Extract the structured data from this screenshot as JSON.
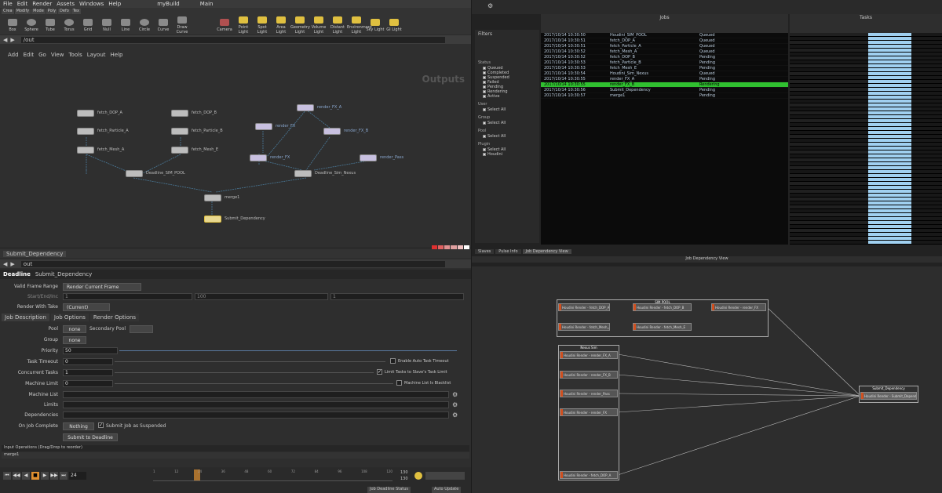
{
  "menubar": [
    "File",
    "Edit",
    "Render",
    "Assets",
    "Windows",
    "Help"
  ],
  "build": "myBuild",
  "desktop": "Main",
  "shelf_tabs": [
    "Crea",
    "Modify",
    "Mode",
    "Poly",
    "Defo",
    "Tex"
  ],
  "shelf_tools": [
    "Box",
    "Sphere",
    "Tube",
    "Torus",
    "Grid",
    "Null",
    "Line",
    "Circle",
    "Curve",
    "Draw Curve"
  ],
  "light_tools": [
    "Camera",
    "Point Light",
    "Spot Light",
    "Area Light",
    "Geometry Light",
    "Volume Light",
    "Distant Light",
    "Environment Light",
    "Sky Light",
    "GI Light"
  ],
  "net_path": "/out",
  "net_menu": [
    "Add",
    "Edit",
    "Go",
    "View",
    "Tools",
    "Layout",
    "Help"
  ],
  "net_title": "Outputs",
  "nodes": {
    "n1": "fetch_DOP_A",
    "n2": "fetch_Particle_A",
    "n3": "fetch_Mesh_A",
    "n4": "fetch_DOP_B",
    "n5": "fetch_Particle_B",
    "n6": "fetch_Mesh_E",
    "n7": "render_FX_A",
    "n8": "render_FX",
    "n9": "render_FX_B",
    "n10": "render_FX",
    "n11": "render_Pass",
    "n12": "Deadline_SIM_POOL",
    "n13": "Deadline_Sim_Nexus",
    "n14": "merge1",
    "n15": "Submit_Dependency"
  },
  "swatch_colors": [
    "#e03030",
    "#e06060",
    "#e09090",
    "#e0a0a0",
    "#f0c0c0",
    "#ffffff",
    "#e08030",
    "#e0b030",
    "#e0e030",
    "#90e030",
    "#30e060",
    "#cccccc",
    "#30e0a0",
    "#30e0e0",
    "#30a0e0",
    "#3060e0",
    "#6030e0",
    "#999999",
    "#a030e0",
    "#e030e0",
    "#e030a0",
    "#a06040",
    "#606060",
    "#444444",
    "#808080",
    "#505050",
    "#c0c0c0",
    "#303030",
    "#707070",
    "#202020"
  ],
  "params": {
    "tab": "Submit_Dependency",
    "path": "out",
    "header_app": "Deadline",
    "header_node": "Submit_Dependency",
    "frame_range_label": "Valid Frame Range",
    "frame_range_value": "Render Current Frame",
    "start_end_label": "Start/End/Inc",
    "start_val": "1",
    "end_val": "100",
    "inc_val": "1",
    "render_takes_label": "Render With Take",
    "render_takes_value": "(Current)",
    "subtabs": [
      "Job Description",
      "Job Options",
      "Render Options"
    ],
    "pool_label": "Pool",
    "pool_value": "none",
    "secpool_label": "Secondary Pool",
    "group_label": "Group",
    "group_value": "none",
    "priority_label": "Priority",
    "priority_value": "50",
    "tasktimeout_label": "Task Timeout",
    "tasktimeout_value": "0",
    "autotimeout_label": "Enable Auto Task Timeout",
    "concurrent_label": "Concurrent Tasks",
    "concurrent_value": "1",
    "limitslave_label": "Limit Tasks to Slave's Task Limit",
    "machinelimit_label": "Machine Limit",
    "machinelimit_value": "0",
    "blacklist_label": "Machine List Is Blacklist",
    "machinelist_label": "Machine List",
    "limits_label": "Limits",
    "dependencies_label": "Dependencies",
    "oncomplete_label": "On Job Complete",
    "oncomplete_value": "Nothing",
    "suspended_label": "Submit Job as Suspended",
    "submit_label": "Submit to Deadline",
    "input_ops": "Input Operations (Drag/Drop to reorder)",
    "input_item": "merge1"
  },
  "timeline": {
    "frame": "24",
    "ticks": [
      "1",
      "12",
      "24",
      "36",
      "48",
      "60",
      "72",
      "84",
      "96",
      "108",
      "120"
    ],
    "end1": "130",
    "end2": "130",
    "jobstatus": "Job Deadline Status",
    "autoupdate": "Auto Update"
  },
  "deadline": {
    "jobs_title": "Jobs",
    "tasks_title": "Tasks",
    "filters": "Filters",
    "dep_title": "Job Dependency View",
    "tabs": [
      "Slaves",
      "Pulse Info",
      "Job Dependency View"
    ],
    "filter_groups": [
      {
        "name": "Status",
        "items": [
          "Queued",
          "Completed",
          "Suspended",
          "Failed",
          "Pending",
          "Rendering",
          "Active"
        ]
      },
      {
        "name": "User",
        "items": [
          "Select All"
        ]
      },
      {
        "name": "Group",
        "items": [
          "Select All"
        ]
      },
      {
        "name": "Pool",
        "items": [
          "Select All"
        ]
      },
      {
        "name": "Plugin",
        "items": [
          "Select All",
          "Houdini"
        ]
      }
    ],
    "jobs": [
      {
        "date": "2017/10/14 10:30:50",
        "name": "Houdini_SIM_POOL",
        "status": "Queued"
      },
      {
        "date": "2017/10/14 10:30:51",
        "name": "fetch_DOP_A",
        "status": "Queued"
      },
      {
        "date": "2017/10/14 10:30:51",
        "name": "fetch_Particle_A",
        "status": "Queued"
      },
      {
        "date": "2017/10/14 10:30:52",
        "name": "fetch_Mesh_A",
        "status": "Queued"
      },
      {
        "date": "2017/10/14 10:30:52",
        "name": "fetch_DOP_B",
        "status": "Pending"
      },
      {
        "date": "2017/10/14 10:30:53",
        "name": "fetch_Particle_B",
        "status": "Pending"
      },
      {
        "date": "2017/10/14 10:30:53",
        "name": "fetch_Mesh_E",
        "status": "Pending"
      },
      {
        "date": "2017/10/14 10:30:54",
        "name": "Houdini_Sim_Nexus",
        "status": "Queued"
      },
      {
        "date": "2017/10/14 10:30:55",
        "name": "render_FX_A",
        "status": "Pending"
      },
      {
        "date": "2017/10/14 10:30:55",
        "name": "render_FX_B",
        "status": "Rendering"
      },
      {
        "date": "2017/10/14 10:30:56",
        "name": "Submit_Dependency",
        "status": "Pending"
      },
      {
        "date": "2017/10/14 10:30:57",
        "name": "merge1",
        "status": "Pending"
      }
    ],
    "dep_pool": "SIM POOL",
    "dep_nexus": "Nexus Sim",
    "dep_submit": "Submit_Dependency",
    "dep_nodes": [
      "Houdini Render - fetch_DOP_A",
      "Houdini Render - fetch_DOP_B",
      "Houdini Render - render_FX",
      "Houdini Render - fetch_Mesh_A",
      "Houdini Render - fetch_Mesh_E",
      "Houdini Render - render_FX_A",
      "Houdini Render - render_FX_B",
      "Houdini Render - render_Pass",
      "Houdini Render - Submit_Dependency"
    ]
  }
}
